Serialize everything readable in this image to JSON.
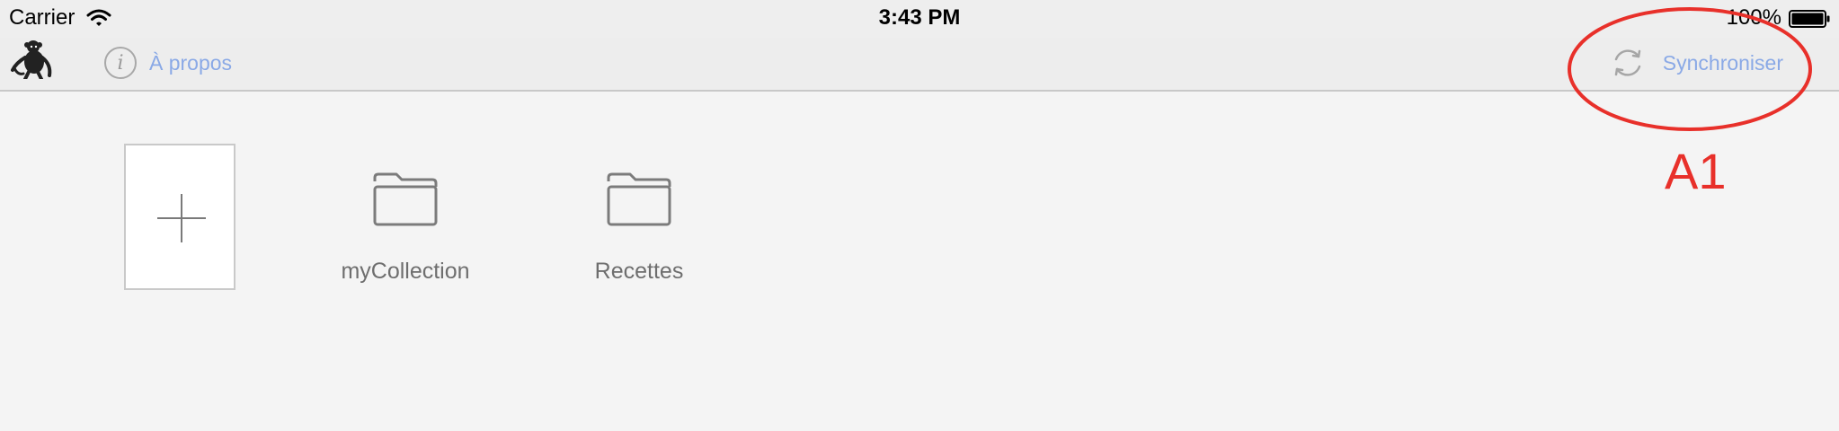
{
  "status_bar": {
    "carrier": "Carrier",
    "time": "3:43 PM",
    "battery": "100%"
  },
  "toolbar": {
    "logo_icon": "monkey-logo-icon",
    "about": {
      "icon": "info-icon",
      "label": "À propos"
    },
    "sync": {
      "icon": "refresh-icon",
      "label": "Synchroniser"
    }
  },
  "annotation": {
    "label": "A1",
    "color": "#e8302a"
  },
  "collections": {
    "add_icon": "plus-icon",
    "items": [
      {
        "label": "myCollection",
        "icon": "folder-icon"
      },
      {
        "label": "Recettes",
        "icon": "folder-icon"
      }
    ]
  },
  "colors": {
    "link": "#8aa9e6",
    "background": "#f4f4f4",
    "toolbar": "#ededed"
  }
}
